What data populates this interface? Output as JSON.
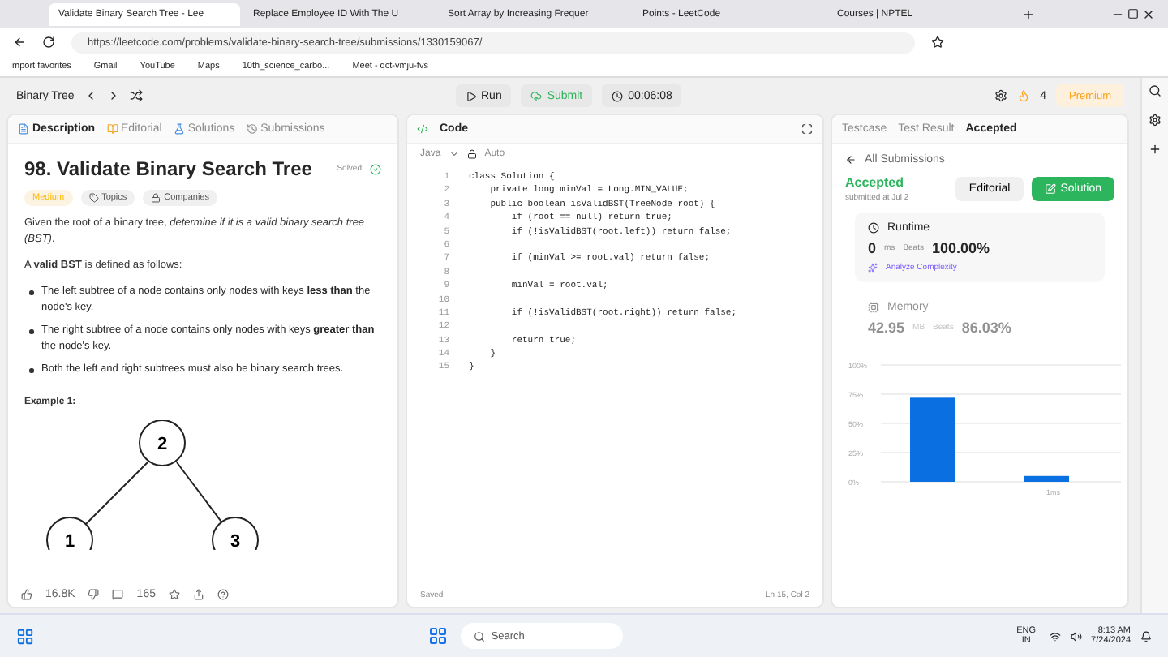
{
  "browser": {
    "tabs": [
      {
        "title": "Validate Binary Search Tree - Lee",
        "selected": true
      },
      {
        "title": "Replace Employee ID With The U",
        "selected": false
      },
      {
        "title": "Sort Array by Increasing Frequer",
        "selected": false
      },
      {
        "title": "Points - LeetCode",
        "selected": false
      },
      {
        "title": "Courses | NPTEL",
        "selected": false
      }
    ],
    "url": "https://leetcode.com/problems/validate-binary-search-tree/submissions/1330159067/",
    "bookmarks": [
      "Import favorites",
      "Gmail",
      "YouTube",
      "Maps",
      "10th_science_carbo...",
      "Meet - qct-vmju-fvs"
    ]
  },
  "header": {
    "problem_list": "Binary Tree",
    "run": "Run",
    "submit": "Submit",
    "timer": "00:06:08",
    "streak": "4",
    "premium": "Premium"
  },
  "description": {
    "tabs": [
      {
        "label": "Description",
        "selected": true
      },
      {
        "label": "Editorial",
        "selected": false
      },
      {
        "label": "Solutions",
        "selected": false
      },
      {
        "label": "Submissions",
        "selected": false
      }
    ],
    "title": "98. Validate Binary Search Tree",
    "status": "Solved",
    "tags": [
      "Medium",
      "Topics",
      "Companies"
    ],
    "intro": "Given the root of a binary tree, *determine if it is a valid binary search tree (BST)*.",
    "definition": "A **valid BST** is defined as follows:",
    "rules": [
      "The left subtree of a node contains only nodes with keys **less than** the node's key.",
      "The right subtree of a node contains only nodes with keys **greater than** the node's key.",
      "Both the left and right subtrees must also be binary search trees."
    ],
    "example_title": "Example 1:",
    "tree": [
      "2",
      "1",
      "3"
    ],
    "likes": "16.8K",
    "comments": "165"
  },
  "code": {
    "title": "Code",
    "language": "Java",
    "mode": "Auto",
    "lines": [
      {
        "number": "1",
        "text": "class Solution {"
      },
      {
        "number": "2",
        "text": "    private long minVal = Long.MIN_VALUE;"
      },
      {
        "number": "3",
        "text": "    public boolean isValidBST(TreeNode root) {"
      },
      {
        "number": "4",
        "text": "        if (root == null) return true;"
      },
      {
        "number": "5",
        "text": "        if (!isValidBST(root.left)) return false;"
      },
      {
        "number": "6"
      },
      {
        "number": "7",
        "text": "        if (minVal >= root.val) return false;"
      },
      {
        "number": "8"
      },
      {
        "number": "9",
        "text": "        minVal = root.val;"
      },
      {
        "number": "10"
      },
      {
        "number": "11",
        "text": "        if (!isValidBST(root.right)) return false;"
      },
      {
        "number": "12"
      },
      {
        "number": "13",
        "text": "        return true;"
      },
      {
        "number": "14",
        "text": "    }"
      },
      {
        "number": "15",
        "text": "}"
      }
    ],
    "status": "Saved",
    "position": "Ln 15, Col 2"
  },
  "result": {
    "tabs": [
      {
        "label": "Testcase",
        "selected": false
      },
      {
        "label": "Test Result",
        "selected": false
      },
      {
        "label": "Accepted",
        "selected": true
      }
    ],
    "back": "All Submissions",
    "verdict": "Accepted",
    "submitted": "submitted at Jul 2",
    "editorial": "Editorial",
    "solution": "Solution",
    "runtime": {
      "label": "Runtime",
      "value": "0",
      "unit": "ms",
      "beats_label": "Beats",
      "beats": "100.00%",
      "analyze": "Analyze Complexity"
    },
    "memory": {
      "label": "Memory",
      "value": "42.95",
      "unit": "MB",
      "beats_label": "Beats",
      "beats": "86.03%"
    },
    "chart_data": {
      "type": "bar",
      "grid": true,
      "values": [
        72,
        5
      ],
      "ylim": [
        0,
        100
      ],
      "yticks": [
        {
          "value": 0,
          "label": "0%"
        },
        {
          "value": 25,
          "label": "25%"
        },
        {
          "value": 50,
          "label": "50%"
        },
        {
          "value": 75,
          "label": "75%"
        },
        {
          "value": 100,
          "label": "100%"
        }
      ]
    },
    "x_label": "1ms"
  },
  "taskbar": {
    "search": "Search",
    "lang": "ENG",
    "region": "IN",
    "time": "8:13 AM",
    "date": "7/24/2024"
  }
}
